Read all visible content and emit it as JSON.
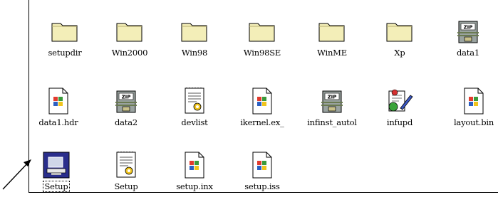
{
  "items": [
    {
      "label": "setupdir",
      "icon": "folder-icon"
    },
    {
      "label": "Win2000",
      "icon": "folder-icon"
    },
    {
      "label": "Win98",
      "icon": "folder-icon"
    },
    {
      "label": "Win98SE",
      "icon": "folder-icon"
    },
    {
      "label": "WinME",
      "icon": "folder-icon"
    },
    {
      "label": "Xp",
      "icon": "folder-icon"
    },
    {
      "label": "data1",
      "icon": "zip-archive-icon"
    },
    {
      "label": "data1.hdr",
      "icon": "windows-file-icon"
    },
    {
      "label": "data2",
      "icon": "zip-archive-icon"
    },
    {
      "label": "devlist",
      "icon": "text-config-icon"
    },
    {
      "label": "ikernel.ex_",
      "icon": "windows-file-icon"
    },
    {
      "label": "infinst_autol",
      "icon": "zip-archive-icon"
    },
    {
      "label": "infupd",
      "icon": "installer-pen-icon"
    },
    {
      "label": "layout.bin",
      "icon": "windows-file-icon"
    },
    {
      "label": "Setup",
      "icon": "setup-computer-icon"
    },
    {
      "label": "Setup",
      "icon": "text-config-icon"
    },
    {
      "label": "setup.inx",
      "icon": "windows-file-icon"
    },
    {
      "label": "setup.iss",
      "icon": "windows-file-icon"
    }
  ],
  "selected_item": "Setup"
}
